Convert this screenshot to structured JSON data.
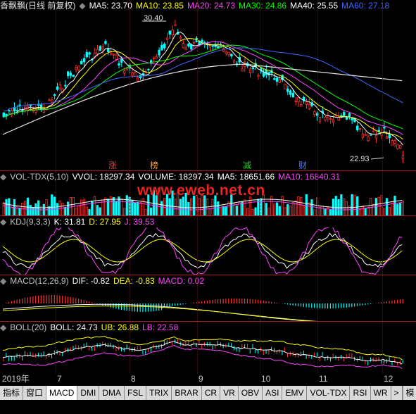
{
  "main": {
    "title": "香飘飘(日线 前复权)",
    "ma": [
      {
        "label": "MA5: 23.70",
        "color": "#ffffff"
      },
      {
        "label": "MA10: 23.85",
        "color": "#ffff00"
      },
      {
        "label": "MA20: 24.73",
        "color": "#ff44ff"
      },
      {
        "label": "MA30: 24.86",
        "color": "#00ff00"
      },
      {
        "label": "MA40: 25.55",
        "color": "#ffffff"
      },
      {
        "label": "MA60: 27.18",
        "color": "#4466ff"
      }
    ],
    "high_label": "30.40",
    "low_label": "22.93",
    "markers": [
      {
        "text": "涨",
        "color": "#ff3030"
      },
      {
        "text": "榜",
        "color": "#ff9a30"
      },
      {
        "text": "减",
        "color": "#30d030"
      },
      {
        "text": "财",
        "color": "#4d7dff"
      }
    ]
  },
  "volume": {
    "labels": [
      {
        "label": "VOL-TDX(5,10)",
        "color": "#c0c0c0"
      },
      {
        "label": "VVOL: 18297.34",
        "color": "#ffffff"
      },
      {
        "label": "VOLUME: 18297.34",
        "color": "#ffffff"
      },
      {
        "label": "MA5: 18651.66",
        "color": "#ffffff"
      },
      {
        "label": "MA10: 16840.31",
        "color": "#ff44ff"
      }
    ]
  },
  "kdj": {
    "labels": [
      {
        "label": "KDJ(9,3,3)",
        "color": "#c0c0c0"
      },
      {
        "label": "K: 31.81",
        "color": "#ffffff"
      },
      {
        "label": "D: 27.95",
        "color": "#ffff00"
      },
      {
        "label": "J: 39.53",
        "color": "#ff44ff"
      }
    ]
  },
  "macd": {
    "labels": [
      {
        "label": "MACD(12,26,9)",
        "color": "#c0c0c0"
      },
      {
        "label": "DIF: -0.82",
        "color": "#ffffff"
      },
      {
        "label": "DEA: -0.83",
        "color": "#ffff00"
      },
      {
        "label": "MACD: 0.02",
        "color": "#ff44ff"
      }
    ]
  },
  "boll": {
    "labels": [
      {
        "label": "BOLL(20)",
        "color": "#c0c0c0"
      },
      {
        "label": "BOLL: 24.73",
        "color": "#ffffff"
      },
      {
        "label": "UB: 26.88",
        "color": "#ffff00"
      },
      {
        "label": "LB: 22.58",
        "color": "#ff44ff"
      }
    ]
  },
  "watermark": "www.eweb.net.cn",
  "dates": [
    "2019年",
    "7",
    "8",
    "9",
    "10",
    "11",
    "12"
  ],
  "tabs": [
    "指标",
    "窗口",
    "MACD",
    "DMI",
    "DMA",
    "FSL",
    "TRIX",
    "BRAR",
    "CR",
    "VR",
    "OBV",
    "ASI",
    "EMV",
    "VOL-TDX",
    "RSI",
    "WR"
  ],
  "tab_more": ">",
  "tab_template": "模板"
}
